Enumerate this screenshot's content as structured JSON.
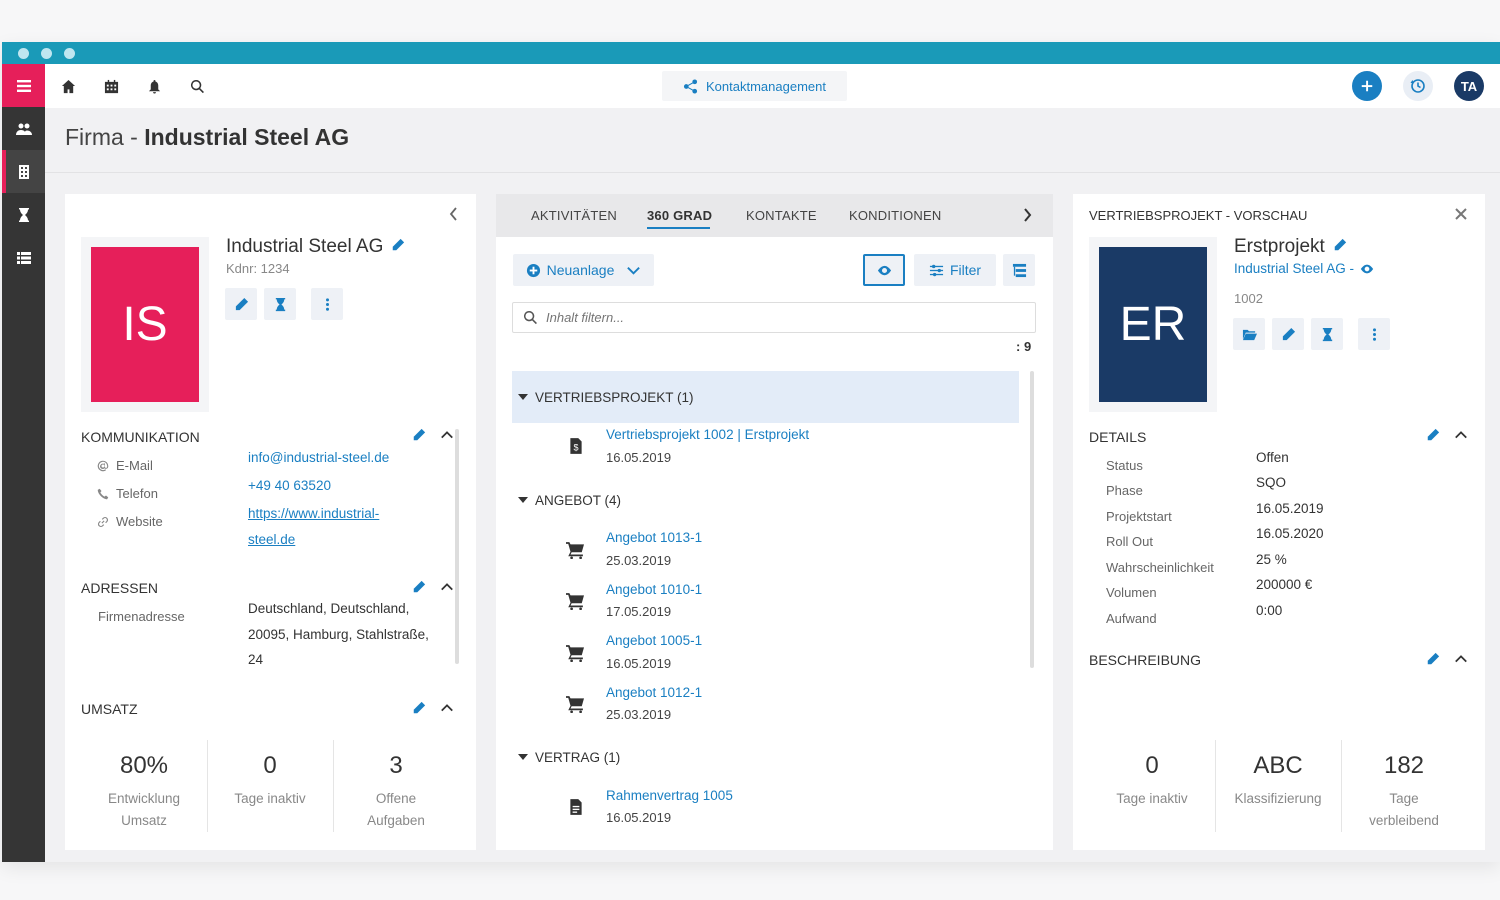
{
  "topbar": {
    "module_label": "Kontaktmanagement",
    "user_initials": "TA"
  },
  "page": {
    "title_prefix": "Firma - ",
    "title_name": "Industrial Steel AG"
  },
  "company": {
    "initials": "IS",
    "avatar_color": "#e61f5a",
    "name": "Industrial Steel AG",
    "customer_no": "Kdnr: 1234",
    "kommunikation": {
      "title": "KOMMUNIKATION",
      "rows": [
        {
          "label": "E-Mail",
          "value": "info@industrial-steel.de"
        },
        {
          "label": "Telefon",
          "value": "+49 40 63520"
        },
        {
          "label": "Website",
          "value_line1": "https://www.industrial-",
          "value_line2": "steel.de"
        }
      ]
    },
    "adressen": {
      "title": "ADRESSEN",
      "label": "Firmenadresse",
      "line1": "Deutschland, Deutschland,",
      "line2": "20095, Hamburg, Stahlstraße,",
      "line3": "24"
    },
    "umsatz": {
      "title": "UMSATZ",
      "stats": [
        {
          "value": "80%",
          "line1": "Entwicklung",
          "line2": "Umsatz"
        },
        {
          "value": "0",
          "line1": "Tage inaktiv",
          "line2": ""
        },
        {
          "value": "3",
          "line1": "Offene",
          "line2": "Aufgaben"
        }
      ]
    }
  },
  "middle": {
    "tabs": [
      "AKTIVITÄTEN",
      "360 GRAD",
      "KONTAKTE",
      "KONDITIONEN"
    ],
    "active_tab": "360 GRAD",
    "new_button": "Neuanlage",
    "filter_button": "Filter",
    "search_placeholder": "Inhalt filtern...",
    "count": ": 9",
    "groups": [
      {
        "title": "VERTRIEBSPROJEKT (1)",
        "items": [
          {
            "title": "Vertriebsprojekt 1002 | Erstprojekt",
            "date": "16.05.2019"
          }
        ]
      },
      {
        "title": "ANGEBOT (4)",
        "items": [
          {
            "title": "Angebot 1013-1",
            "date": "25.03.2019"
          },
          {
            "title": "Angebot 1010-1",
            "date": "17.05.2019"
          },
          {
            "title": "Angebot 1005-1",
            "date": "16.05.2019"
          },
          {
            "title": "Angebot 1012-1",
            "date": "25.03.2019"
          }
        ]
      },
      {
        "title": "VERTRAG (1)",
        "items": [
          {
            "title": "Rahmenvertrag 1005",
            "date": "16.05.2019"
          }
        ]
      }
    ]
  },
  "preview": {
    "header": "VERTRIEBSPROJEKT - VORSCHAU",
    "initials": "ER",
    "avatar_color": "#1a3a66",
    "name": "Erstprojekt",
    "company_link": "Industrial Steel AG -",
    "number": "1002",
    "details_title": "DETAILS",
    "details": [
      {
        "label": "Status",
        "value": "Offen"
      },
      {
        "label": "Phase",
        "value": "SQO"
      },
      {
        "label": "Projektstart",
        "value": "16.05.2019"
      },
      {
        "label": "Roll Out",
        "value": "16.05.2020"
      },
      {
        "label": "Wahrscheinlichkeit",
        "value": "25 %"
      },
      {
        "label": "Volumen",
        "value": "200000 €"
      },
      {
        "label": "Aufwand",
        "value": "0:00"
      }
    ],
    "beschreibung_title": "BESCHREIBUNG",
    "stats": [
      {
        "value": "0",
        "line1": "Tage inaktiv",
        "line2": ""
      },
      {
        "value": "ABC",
        "line1": "Klassifizierung",
        "line2": ""
      },
      {
        "value": "182",
        "line1": "Tage",
        "line2": "verbleibend"
      }
    ]
  },
  "colors": {
    "accent": "#1a7fc2",
    "titlebar": "#1a9ab8",
    "sidebar": "#353535",
    "highlight": "#e61f5a"
  }
}
